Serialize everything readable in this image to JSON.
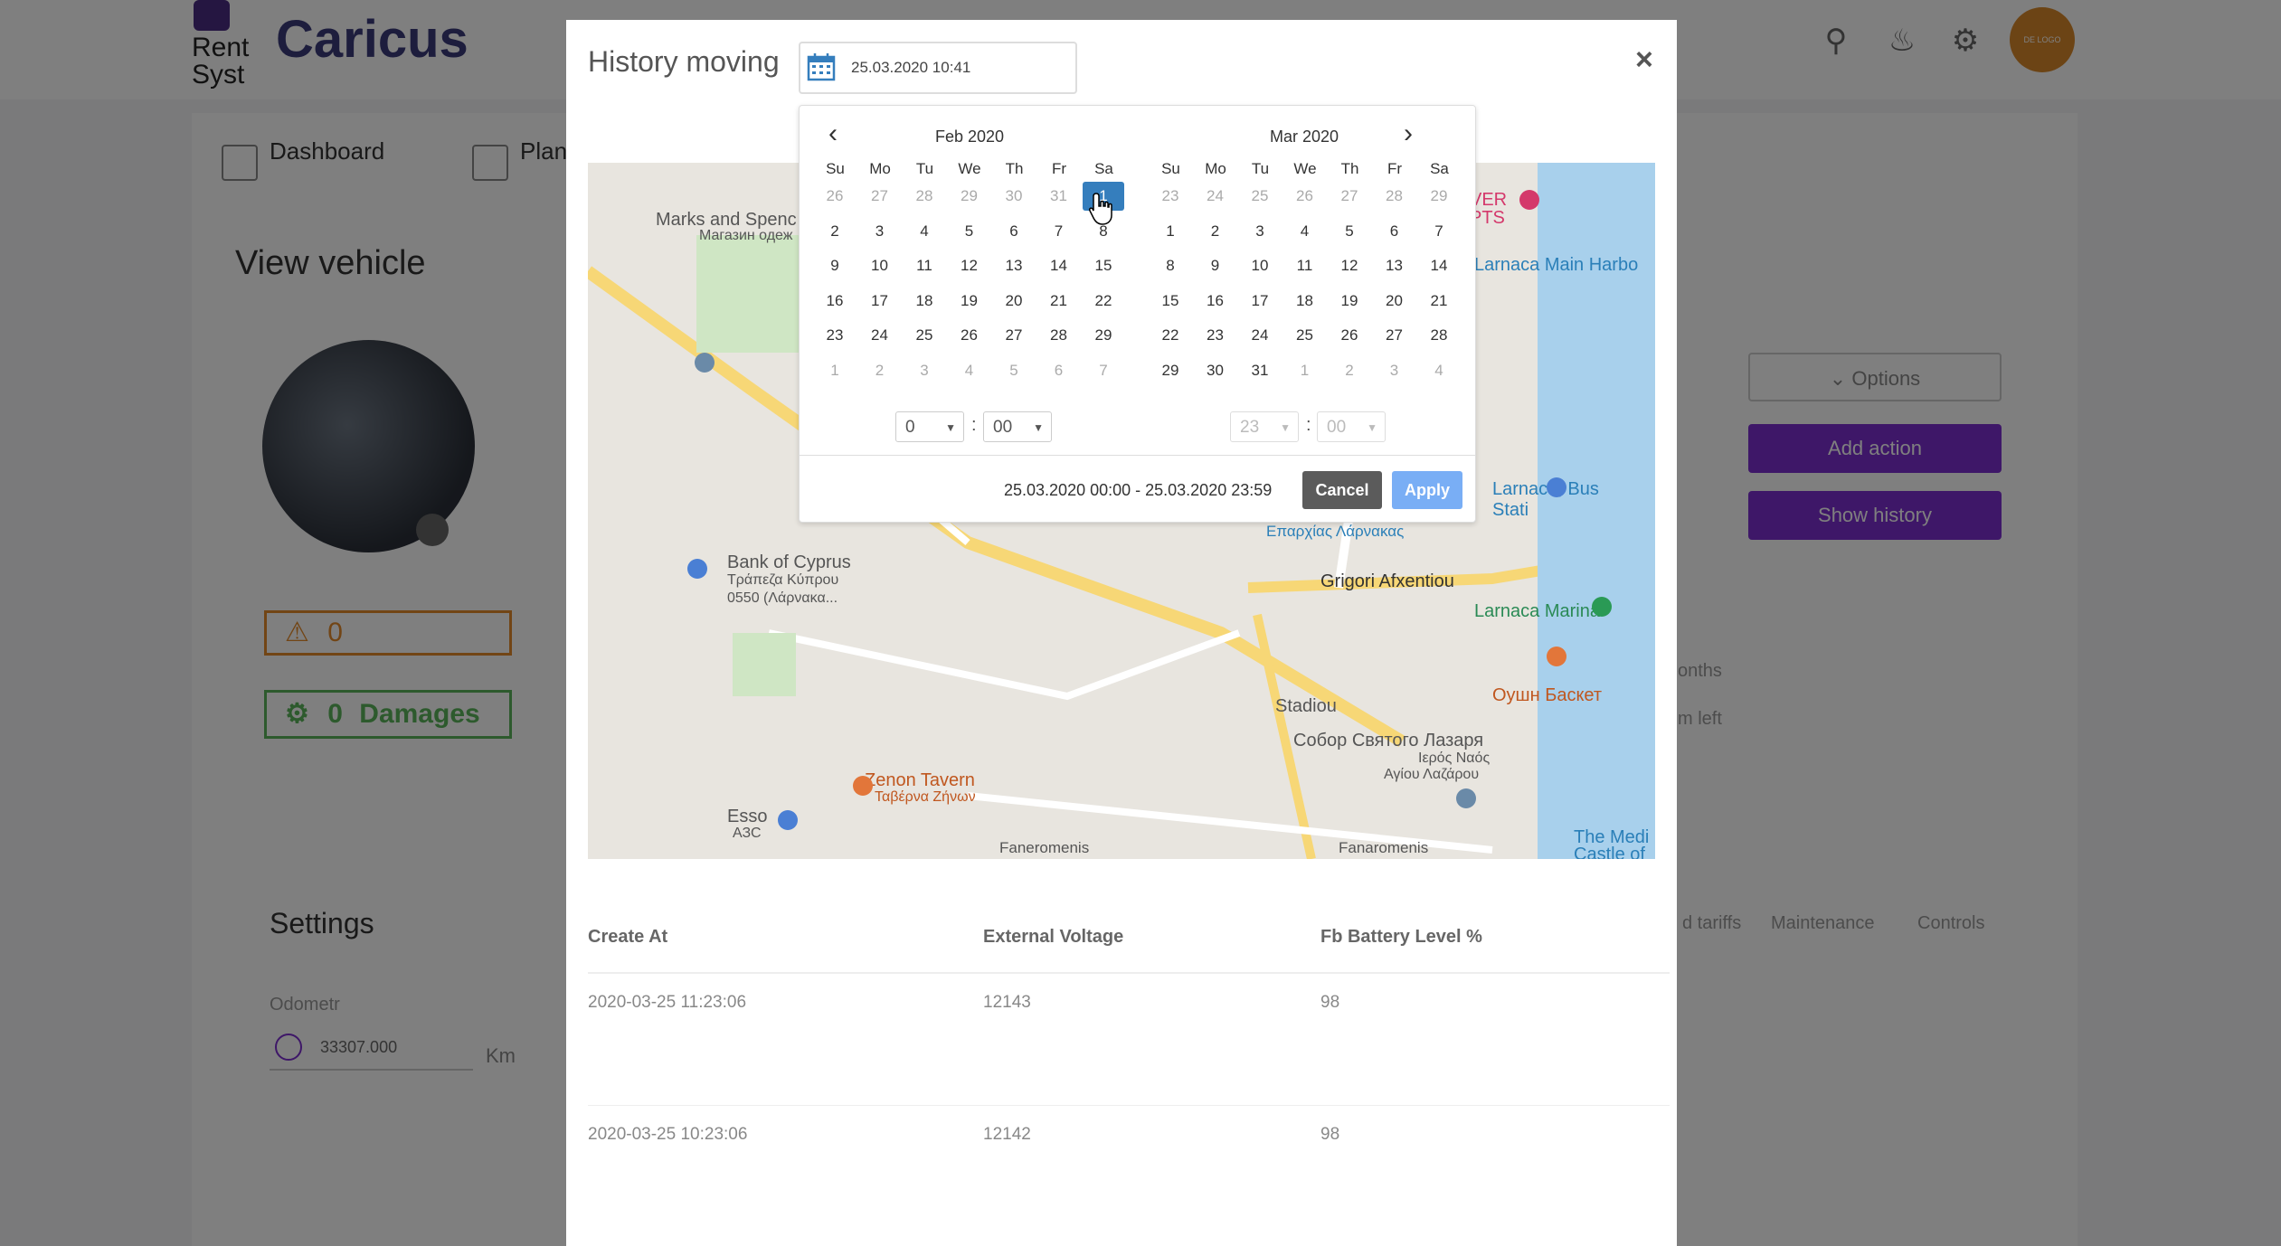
{
  "app": {
    "brand": "Caricus",
    "logo_text_1": "Rent",
    "logo_text_2": "Syst",
    "avatar_text": "DE LOGO"
  },
  "nav": {
    "items": [
      {
        "label": "Dashboard"
      },
      {
        "label": "Plan"
      }
    ]
  },
  "page": {
    "title": "View vehicle",
    "alerts_count": "0",
    "damages_count": "0",
    "damages_label": "Damages",
    "options_label": "Options",
    "add_action_label": "Add action",
    "show_history_label": "Show history",
    "months_fragment": "onths",
    "left_fragment": "m left"
  },
  "settings": {
    "title": "Settings",
    "odometer_label": "Odometr",
    "odometer_value": "33307.000",
    "odometer_unit": "Km",
    "tabs": [
      "d tariffs",
      "Maintenance",
      "Controls"
    ]
  },
  "modal": {
    "title": "History moving",
    "date_value": "25.03.2020 10:41",
    "close_label": "×"
  },
  "calendar": {
    "left": {
      "month_label": "Feb 2020",
      "weekdays": [
        "Su",
        "Mo",
        "Tu",
        "We",
        "Th",
        "Fr",
        "Sa"
      ],
      "weeks": [
        [
          {
            "d": "26",
            "off": true
          },
          {
            "d": "27",
            "off": true
          },
          {
            "d": "28",
            "off": true
          },
          {
            "d": "29",
            "off": true
          },
          {
            "d": "30",
            "off": true
          },
          {
            "d": "31",
            "off": true
          },
          {
            "d": "1",
            "sel": true
          }
        ],
        [
          {
            "d": "2"
          },
          {
            "d": "3"
          },
          {
            "d": "4"
          },
          {
            "d": "5"
          },
          {
            "d": "6"
          },
          {
            "d": "7"
          },
          {
            "d": "8"
          }
        ],
        [
          {
            "d": "9"
          },
          {
            "d": "10"
          },
          {
            "d": "11"
          },
          {
            "d": "12"
          },
          {
            "d": "13"
          },
          {
            "d": "14"
          },
          {
            "d": "15"
          }
        ],
        [
          {
            "d": "16"
          },
          {
            "d": "17"
          },
          {
            "d": "18"
          },
          {
            "d": "19"
          },
          {
            "d": "20"
          },
          {
            "d": "21"
          },
          {
            "d": "22"
          }
        ],
        [
          {
            "d": "23"
          },
          {
            "d": "24"
          },
          {
            "d": "25"
          },
          {
            "d": "26"
          },
          {
            "d": "27"
          },
          {
            "d": "28"
          },
          {
            "d": "29"
          }
        ],
        [
          {
            "d": "1",
            "off": true
          },
          {
            "d": "2",
            "off": true
          },
          {
            "d": "3",
            "off": true
          },
          {
            "d": "4",
            "off": true
          },
          {
            "d": "5",
            "off": true
          },
          {
            "d": "6",
            "off": true
          },
          {
            "d": "7",
            "off": true
          }
        ]
      ],
      "hour": "0",
      "minute": "00"
    },
    "right": {
      "month_label": "Mar 2020",
      "weekdays": [
        "Su",
        "Mo",
        "Tu",
        "We",
        "Th",
        "Fr",
        "Sa"
      ],
      "weeks": [
        [
          {
            "d": "23",
            "off": true
          },
          {
            "d": "24",
            "off": true
          },
          {
            "d": "25",
            "off": true
          },
          {
            "d": "26",
            "off": true
          },
          {
            "d": "27",
            "off": true
          },
          {
            "d": "28",
            "off": true
          },
          {
            "d": "29",
            "off": true
          }
        ],
        [
          {
            "d": "1"
          },
          {
            "d": "2"
          },
          {
            "d": "3"
          },
          {
            "d": "4"
          },
          {
            "d": "5"
          },
          {
            "d": "6"
          },
          {
            "d": "7"
          }
        ],
        [
          {
            "d": "8"
          },
          {
            "d": "9"
          },
          {
            "d": "10"
          },
          {
            "d": "11"
          },
          {
            "d": "12"
          },
          {
            "d": "13"
          },
          {
            "d": "14"
          }
        ],
        [
          {
            "d": "15"
          },
          {
            "d": "16"
          },
          {
            "d": "17"
          },
          {
            "d": "18"
          },
          {
            "d": "19"
          },
          {
            "d": "20"
          },
          {
            "d": "21"
          }
        ],
        [
          {
            "d": "22"
          },
          {
            "d": "23"
          },
          {
            "d": "24"
          },
          {
            "d": "25"
          },
          {
            "d": "26"
          },
          {
            "d": "27"
          },
          {
            "d": "28"
          }
        ],
        [
          {
            "d": "29"
          },
          {
            "d": "30"
          },
          {
            "d": "31"
          },
          {
            "d": "1",
            "off": true
          },
          {
            "d": "2",
            "off": true
          },
          {
            "d": "3",
            "off": true
          },
          {
            "d": "4",
            "off": true
          }
        ]
      ],
      "hour": "23",
      "minute": "00"
    },
    "range_text": "25.03.2020 00:00 - 25.03.2020 23:59",
    "cancel_label": "Cancel",
    "apply_label": "Apply"
  },
  "map": {
    "labels": [
      "Marks and Spenc",
      "Магазин одеж",
      "Larnaca Main Harbo",
      "Larnaca, Bus Stati",
      "Bank of Cyprus",
      "Τράπεζα Κύπρου",
      "0550 (Λάρνακα...",
      "Grigori Afxentiou",
      "Larnaca Marina",
      "Оушн Баскет",
      "Собор Святого Лазаря",
      "Ιερός Ναός",
      "Αγίου Λαζάρου",
      "Zenon Tavern",
      "Ταβέρνα Ζήνων",
      "Esso",
      "АЗС",
      "Faneromenis",
      "Fanaromenis",
      "The Medi",
      "Castle of",
      "Stadiou",
      "Επαρχίας Λάρνακας",
      "VER",
      "PTS"
    ]
  },
  "table": {
    "headers": [
      "Create At",
      "External Voltage",
      "Fb Battery Level %"
    ],
    "rows": [
      [
        "2020-03-25 11:23:06",
        "12143",
        "98"
      ],
      [
        "2020-03-25 10:23:06",
        "12142",
        "98"
      ]
    ]
  }
}
